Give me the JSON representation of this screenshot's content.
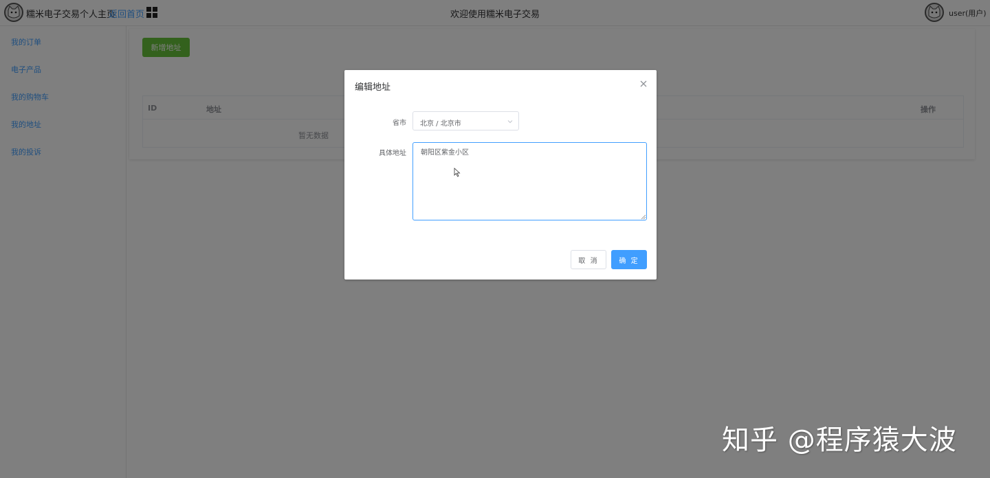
{
  "header": {
    "site_title": "糯米电子交易个人主页",
    "home_link": "返回首页",
    "welcome": "欢迎使用糯米电子交易",
    "user_name": "user(用户)"
  },
  "sidebar": {
    "items": [
      {
        "label": "我的订单"
      },
      {
        "label": "电子产品"
      },
      {
        "label": "我的购物车"
      },
      {
        "label": "我的地址"
      },
      {
        "label": "我的投诉"
      }
    ]
  },
  "main": {
    "add_button": "新增地址",
    "table": {
      "columns": [
        "ID",
        "地址",
        "操作"
      ],
      "empty_text": "暂无数据"
    }
  },
  "dialog": {
    "title": "编辑地址",
    "province_label": "省市",
    "province_value": "北京 / 北京市",
    "address_label": "具体地址",
    "address_value": "朝阳区紫金小区",
    "cancel_label": "取 消",
    "confirm_label": "确 定"
  },
  "watermark": "知乎 @程序猿大波",
  "colors": {
    "primary": "#409eff",
    "success": "#67c23a",
    "mask": "rgba(0,0,0,0.5)"
  }
}
